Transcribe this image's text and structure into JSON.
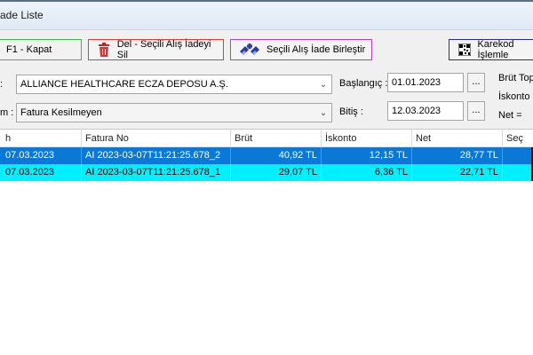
{
  "window": {
    "title": "ade Liste"
  },
  "toolbar": {
    "close_label": "F1 - Kapat",
    "delete_label": "Del - Seçili Alış İadeyi Sil",
    "merge_label": "Seçili Alış İade Birleştir",
    "qr_label": "Karekod İşlemle"
  },
  "filters": {
    "supplier_label": ":",
    "supplier_value": "ALLIANCE HEALTHCARE ECZA DEPOSU A.Ş.",
    "status_label": "m :",
    "status_value": "Fatura Kesilmeyen",
    "start_label": "Başlangıç :",
    "start_value": "01.01.2023",
    "end_label": "Bitiş :",
    "end_value": "12.03.2023",
    "picker_label": "..."
  },
  "summary": {
    "gross_label": "Brüt Topl",
    "discount_label": "İskonto =",
    "net_label": "Net ="
  },
  "table": {
    "headers": [
      "h",
      "Fatura No",
      "Brüt",
      "İskonto",
      "Net",
      "Seç"
    ],
    "rows": [
      [
        "07.03.2023",
        "AI 2023-03-07T11:21:25.678_2",
        "40,92 TL",
        "12,15 TL",
        "28,77 TL",
        ""
      ],
      [
        "07.03.2023",
        "AI 2023-03-07T11:21:25.678_1",
        "29,07 TL",
        "6,36 TL",
        "22,71 TL",
        ""
      ]
    ]
  },
  "colors": {
    "selected_row": "#0a78d6",
    "alt_row": "#00f0ff",
    "close_border": "#3cb54a",
    "delete_border": "#d64040",
    "merge_border": "#b040c0",
    "qr_border": "#2a2a9a"
  },
  "icons": {
    "delete": "trash-icon",
    "merge": "pills-icon",
    "qr": "qr-code-icon"
  }
}
